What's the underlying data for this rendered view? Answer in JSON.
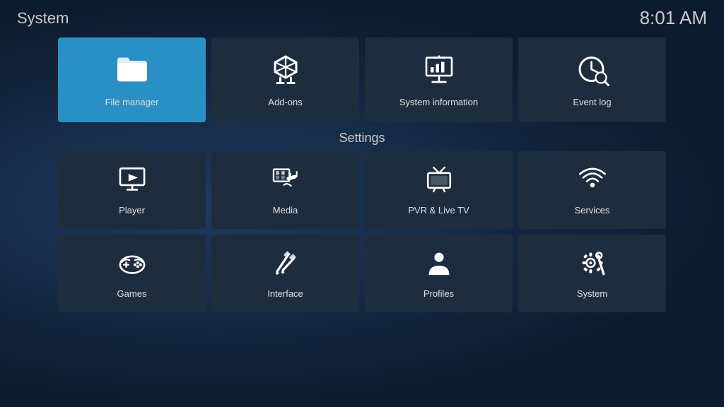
{
  "topbar": {
    "title": "System",
    "time": "8:01 AM"
  },
  "top_tiles": [
    {
      "id": "file-manager",
      "label": "File manager",
      "active": true
    },
    {
      "id": "add-ons",
      "label": "Add-ons",
      "active": false
    },
    {
      "id": "system-information",
      "label": "System information",
      "active": false
    },
    {
      "id": "event-log",
      "label": "Event log",
      "active": false
    }
  ],
  "settings_label": "Settings",
  "settings_row1": [
    {
      "id": "player",
      "label": "Player"
    },
    {
      "id": "media",
      "label": "Media"
    },
    {
      "id": "pvr-live-tv",
      "label": "PVR & Live TV"
    },
    {
      "id": "services",
      "label": "Services"
    }
  ],
  "settings_row2": [
    {
      "id": "games",
      "label": "Games"
    },
    {
      "id": "interface",
      "label": "Interface"
    },
    {
      "id": "profiles",
      "label": "Profiles"
    },
    {
      "id": "system",
      "label": "System"
    }
  ]
}
